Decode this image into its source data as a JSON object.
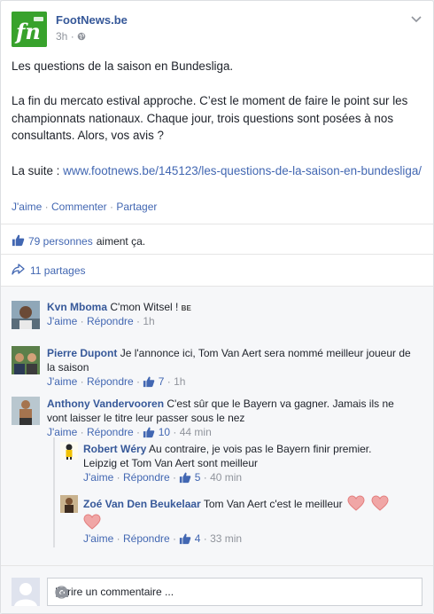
{
  "page": {
    "name": "FootNews.be",
    "time": "3h",
    "logo_text": "fn"
  },
  "post": {
    "line1": "Les questions de la saison en Bundesliga.",
    "line2": "La fin du mercato estival approche. C’est le moment de faire le point sur les championnats nationaux. Chaque jour, trois questions sont posées à nos consultants. Alors, vos avis ?",
    "more_prefix": "La suite : ",
    "more_link": "www.footnews.be/145123/les-questions-de-la-saison-en-bundesliga/"
  },
  "actions": {
    "like": "J'aime",
    "comment": "Commenter",
    "share": "Partager",
    "sep": " · "
  },
  "likes": {
    "count_text": "79 personnes",
    "suffix": "aiment ça."
  },
  "shares": {
    "text": "11 partages"
  },
  "comments": [
    {
      "name": "Kvn Mboma",
      "text": "C'mon Witsel ! ",
      "flag": "BE",
      "like": "J'aime",
      "reply": "Répondre",
      "time": "1h"
    },
    {
      "name": "Pierre Dupont",
      "text": "Je l'annonce ici, Tom Van Aert sera nommé meilleur joueur de la saison",
      "like": "J'aime",
      "reply": "Répondre",
      "likes": "7",
      "time": "1h"
    },
    {
      "name": "Anthony Vandervooren",
      "text": "C'est sûr que le Bayern va gagner. Jamais ils ne vont laisser le titre leur passer sous le nez",
      "like": "J'aime",
      "reply": "Répondre",
      "likes": "10",
      "time": "44 min"
    }
  ],
  "replies": [
    {
      "name": "Robert Wéry",
      "text": "Au contraire, je vois pas le Bayern finir premier. Leipzig et Tom Van Aert sont meilleur",
      "like": "J'aime",
      "reply": "Répondre",
      "likes": "5",
      "time": "40 min"
    },
    {
      "name": "Zoé Van Den Beukelaar",
      "text": "Tom Van Aert c'est le meilleur",
      "like": "J'aime",
      "reply": "Répondre",
      "likes": "4",
      "time": "33 min"
    }
  ],
  "composer": {
    "placeholder": "Ecrire un commentaire ..."
  },
  "colors": {
    "link": "#4267b2",
    "name": "#365899",
    "brand": "#38a22c",
    "heart": "#f0a6a6"
  },
  "icons": [
    "chevron-down-icon",
    "globe-icon",
    "thumbs-up-icon",
    "share-arrow-icon",
    "heart-icon",
    "camera-icon",
    "smiley-icon"
  ]
}
